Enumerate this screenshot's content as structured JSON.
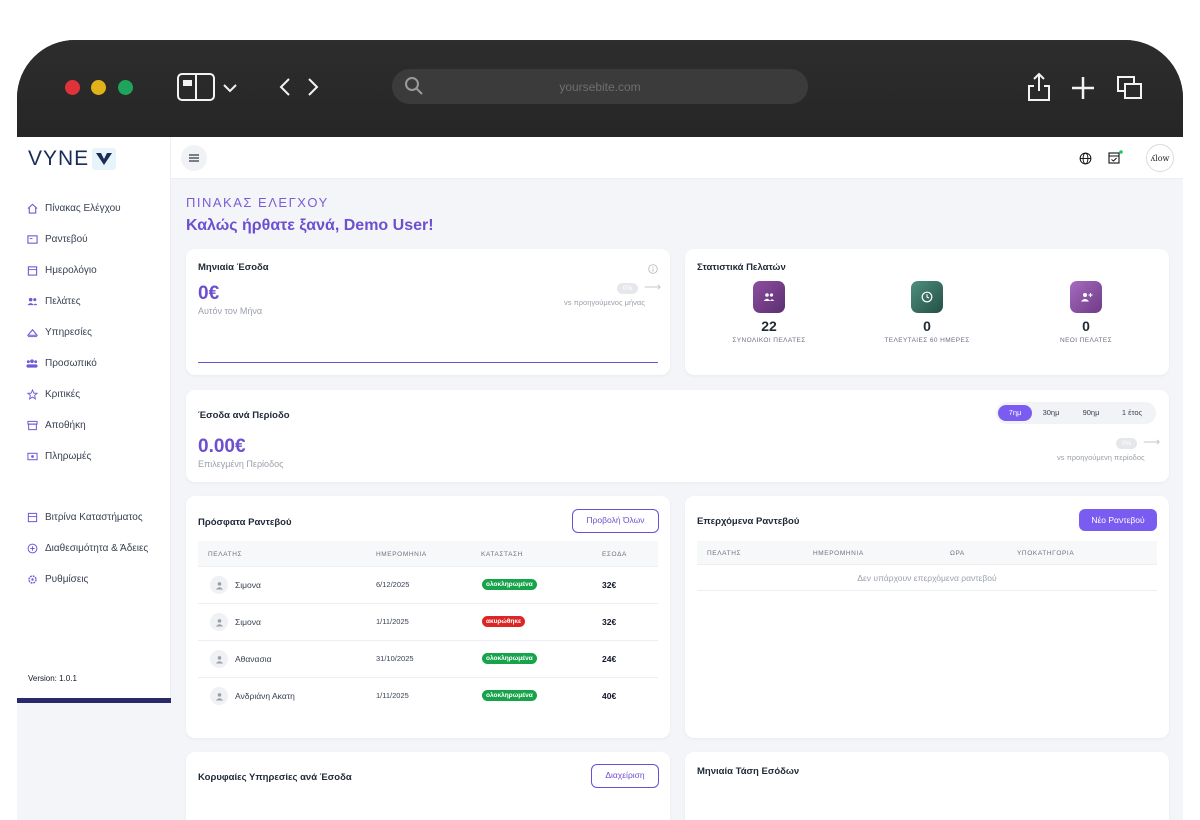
{
  "browser": {
    "url": "yoursebite.com"
  },
  "sidebar": {
    "logo": "VYNE",
    "items": [
      {
        "label": "Πίνακας Ελέγχου",
        "icon": "home-icon"
      },
      {
        "label": "Ραντεβού",
        "icon": "calendar-card-icon"
      },
      {
        "label": "Ημερολόγιο",
        "icon": "calendar-icon"
      },
      {
        "label": "Πελάτες",
        "icon": "users-icon"
      },
      {
        "label": "Υπηρεσίες",
        "icon": "services-icon"
      },
      {
        "label": "Προσωπικό",
        "icon": "staff-icon"
      },
      {
        "label": "Κριτικές",
        "icon": "star-icon"
      },
      {
        "label": "Αποθήκη",
        "icon": "archive-icon"
      },
      {
        "label": "Πληρωμές",
        "icon": "payments-icon"
      }
    ],
    "items2": [
      {
        "label": "Βιτρίνα Καταστήματος",
        "icon": "storefront-icon"
      },
      {
        "label": "Διαθεσιμότητα & Άδειες",
        "icon": "availability-icon"
      },
      {
        "label": "Ρυθμίσεις",
        "icon": "gear-icon"
      }
    ],
    "version": "Version: 1.0.1"
  },
  "header": {
    "avatar_text": "ʎlow"
  },
  "page": {
    "section_title": "ΠΙΝΑΚΑΣ ΕΛΕΓΧΟΥ",
    "welcome": "Καλώς ήρθατε ξανά, Demo User!"
  },
  "monthly_income": {
    "title": "Μηνιαία Έσοδα",
    "value": "0€",
    "subtitle": "Αυτόν τον Μήνα",
    "change": "0%",
    "compare": "vs προηγούμενος μήνας"
  },
  "customer_stats": {
    "title": "Στατιστικά Πελατών",
    "stats": [
      {
        "value": "22",
        "label": "ΣΥΝΟΛΙΚΟΙ ΠΕΛΑΤΕΣ",
        "color": "#7a3f86",
        "icon": "users-icon"
      },
      {
        "value": "0",
        "label": "ΤΕΛΕΥΤΑΙΕΣ 60 ΗΜΕΡΕΣ",
        "color": "#2f6b5c",
        "icon": "clock-icon"
      },
      {
        "value": "0",
        "label": "ΝΕΟΙ ΠΕΛΑΤΕΣ",
        "color": "#8a4fa0",
        "icon": "user-plus-icon"
      }
    ]
  },
  "period_income": {
    "title": "Έσοδα ανά Περίοδο",
    "value": "0.00€",
    "subtitle": "Επιλεγμένη Περίοδος",
    "change": "0%",
    "compare": "vs προηγούμενη περίοδος",
    "periods": [
      "7ημ",
      "30ημ",
      "90ημ",
      "1 έτος"
    ],
    "selected_period": "7ημ"
  },
  "recent_appointments": {
    "title": "Πρόσφατα Ραντεβού",
    "view_all": "Προβολή Όλων",
    "headers": [
      "ΠΕΛΑΤΗΣ",
      "ΗΜΕΡΟΜΗΝΙΑ",
      "ΚΑΤΑΣΤΑΣΗ",
      "ΕΣΟΔΑ"
    ],
    "rows": [
      {
        "customer": "Σιμονα",
        "date": "6/12/2025",
        "status": "ολοκληρωμένα",
        "status_color": "#16a34a",
        "amount": "32€"
      },
      {
        "customer": "Σιμονα",
        "date": "1/11/2025",
        "status": "ακυρώθηκε",
        "status_color": "#dc2626",
        "amount": "32€"
      },
      {
        "customer": "Αθανασια",
        "date": "31/10/2025",
        "status": "ολοκληρωμένα",
        "status_color": "#16a34a",
        "amount": "24€"
      },
      {
        "customer": "Ανδριάνη Ακατη",
        "date": "1/11/2025",
        "status": "ολοκληρωμένα",
        "status_color": "#16a34a",
        "amount": "40€"
      }
    ]
  },
  "upcoming_appointments": {
    "title": "Επερχόμενα Ραντεβού",
    "new_button": "Νέο Ραντεβού",
    "headers": [
      "ΠΕΛΑΤΗΣ",
      "ΗΜΕΡΟΜΗΝΙΑ",
      "ΩΡΑ",
      "ΥΠΟΚΑΤΗΓΟΡΙΑ"
    ],
    "empty": "Δεν υπάρχουν επερχόμενα ραντεβού"
  },
  "top_services": {
    "title": "Κορυφαίες Υπηρεσίες ανά Έσοδα",
    "manage": "Διαχείριση"
  },
  "monthly_trend": {
    "title": "Μηνιαία Τάση Εσόδων"
  },
  "colors": {
    "accent": "#6d4fd0",
    "button": "#7b5cf0"
  }
}
